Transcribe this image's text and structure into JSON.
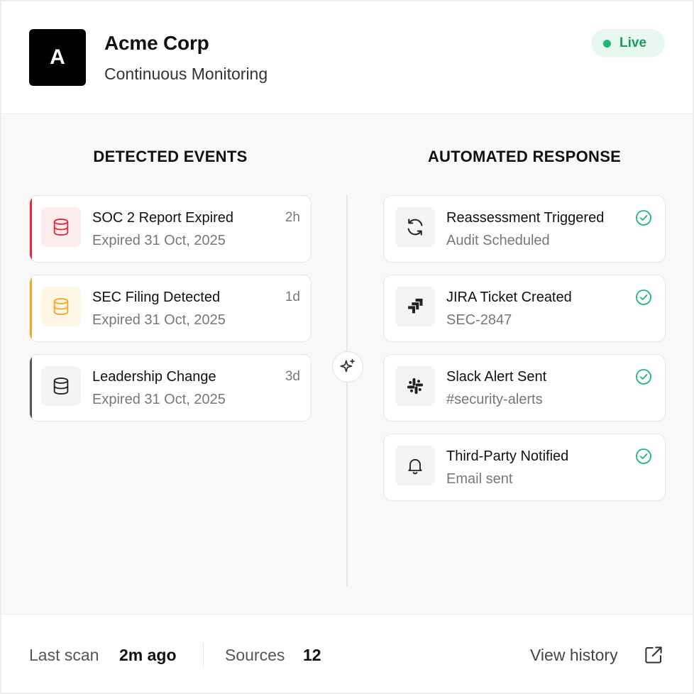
{
  "header": {
    "avatar_letter": "A",
    "company": "Acme Corp",
    "subtitle": "Continuous Monitoring",
    "status_label": "Live",
    "status_color": "#22b573"
  },
  "columns": {
    "events_title": "DETECTED EVENTS",
    "response_title": "AUTOMATED RESPONSE"
  },
  "events": [
    {
      "title": "SOC 2 Report Expired",
      "subtitle": "Expired 31 Oct, 2025",
      "time": "2h",
      "accent": "#e5283c",
      "icon": "database-icon"
    },
    {
      "title": "SEC Filing Detected",
      "subtitle": "Expired 31 Oct, 2025",
      "time": "1d",
      "accent": "#f5a623",
      "icon": "database-icon"
    },
    {
      "title": "Leadership Change",
      "subtitle": "Expired 31 Oct, 2025",
      "time": "3d",
      "accent": "#555555",
      "icon": "database-icon"
    }
  ],
  "responses": [
    {
      "title": "Reassessment Triggered",
      "subtitle": "Audit Scheduled",
      "icon": "refresh-icon"
    },
    {
      "title": "JIRA Ticket Created",
      "subtitle": "SEC-2847",
      "icon": "jira-icon"
    },
    {
      "title": "Slack Alert Sent",
      "subtitle": "#security-alerts",
      "icon": "slack-icon"
    },
    {
      "title": "Third-Party Notified",
      "subtitle": "Email sent",
      "icon": "bell-icon"
    }
  ],
  "footer": {
    "last_scan_label": "Last scan",
    "last_scan_value": "2m ago",
    "sources_label": "Sources",
    "sources_value": "12",
    "history_link": "View history"
  }
}
